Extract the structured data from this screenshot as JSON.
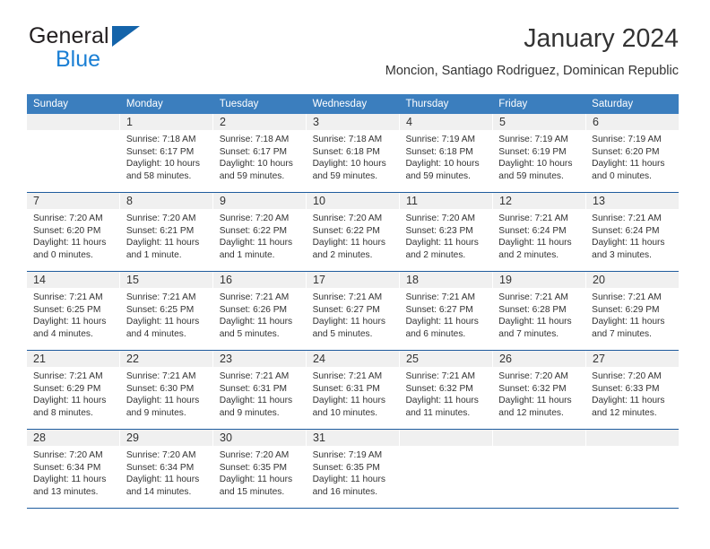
{
  "brand": {
    "name_top": "General",
    "name_bottom": "Blue",
    "triangle_color": "#1464aa",
    "blue_text_color": "#1a7fd4"
  },
  "header": {
    "title": "January 2024",
    "subtitle": "Moncion, Santiago Rodriguez, Dominican Republic"
  },
  "colors": {
    "header_blue": "#3b7ebe",
    "week_divider": "#1f5c9e",
    "daynum_band": "#f0f0f0",
    "text": "#333333"
  },
  "weekdays": [
    "Sunday",
    "Monday",
    "Tuesday",
    "Wednesday",
    "Thursday",
    "Friday",
    "Saturday"
  ],
  "labels": {
    "sunrise_prefix": "Sunrise:",
    "sunset_prefix": "Sunset:",
    "daylight_prefix": "Daylight:"
  },
  "weeks": [
    [
      {
        "day": "",
        "line1": "",
        "line2": "",
        "line3": "",
        "line4": ""
      },
      {
        "day": "1",
        "line1": "Sunrise: 7:18 AM",
        "line2": "Sunset: 6:17 PM",
        "line3": "Daylight: 10 hours",
        "line4": "and 58 minutes."
      },
      {
        "day": "2",
        "line1": "Sunrise: 7:18 AM",
        "line2": "Sunset: 6:17 PM",
        "line3": "Daylight: 10 hours",
        "line4": "and 59 minutes."
      },
      {
        "day": "3",
        "line1": "Sunrise: 7:18 AM",
        "line2": "Sunset: 6:18 PM",
        "line3": "Daylight: 10 hours",
        "line4": "and 59 minutes."
      },
      {
        "day": "4",
        "line1": "Sunrise: 7:19 AM",
        "line2": "Sunset: 6:18 PM",
        "line3": "Daylight: 10 hours",
        "line4": "and 59 minutes."
      },
      {
        "day": "5",
        "line1": "Sunrise: 7:19 AM",
        "line2": "Sunset: 6:19 PM",
        "line3": "Daylight: 10 hours",
        "line4": "and 59 minutes."
      },
      {
        "day": "6",
        "line1": "Sunrise: 7:19 AM",
        "line2": "Sunset: 6:20 PM",
        "line3": "Daylight: 11 hours",
        "line4": "and 0 minutes."
      }
    ],
    [
      {
        "day": "7",
        "line1": "Sunrise: 7:20 AM",
        "line2": "Sunset: 6:20 PM",
        "line3": "Daylight: 11 hours",
        "line4": "and 0 minutes."
      },
      {
        "day": "8",
        "line1": "Sunrise: 7:20 AM",
        "line2": "Sunset: 6:21 PM",
        "line3": "Daylight: 11 hours",
        "line4": "and 1 minute."
      },
      {
        "day": "9",
        "line1": "Sunrise: 7:20 AM",
        "line2": "Sunset: 6:22 PM",
        "line3": "Daylight: 11 hours",
        "line4": "and 1 minute."
      },
      {
        "day": "10",
        "line1": "Sunrise: 7:20 AM",
        "line2": "Sunset: 6:22 PM",
        "line3": "Daylight: 11 hours",
        "line4": "and 2 minutes."
      },
      {
        "day": "11",
        "line1": "Sunrise: 7:20 AM",
        "line2": "Sunset: 6:23 PM",
        "line3": "Daylight: 11 hours",
        "line4": "and 2 minutes."
      },
      {
        "day": "12",
        "line1": "Sunrise: 7:21 AM",
        "line2": "Sunset: 6:24 PM",
        "line3": "Daylight: 11 hours",
        "line4": "and 2 minutes."
      },
      {
        "day": "13",
        "line1": "Sunrise: 7:21 AM",
        "line2": "Sunset: 6:24 PM",
        "line3": "Daylight: 11 hours",
        "line4": "and 3 minutes."
      }
    ],
    [
      {
        "day": "14",
        "line1": "Sunrise: 7:21 AM",
        "line2": "Sunset: 6:25 PM",
        "line3": "Daylight: 11 hours",
        "line4": "and 4 minutes."
      },
      {
        "day": "15",
        "line1": "Sunrise: 7:21 AM",
        "line2": "Sunset: 6:25 PM",
        "line3": "Daylight: 11 hours",
        "line4": "and 4 minutes."
      },
      {
        "day": "16",
        "line1": "Sunrise: 7:21 AM",
        "line2": "Sunset: 6:26 PM",
        "line3": "Daylight: 11 hours",
        "line4": "and 5 minutes."
      },
      {
        "day": "17",
        "line1": "Sunrise: 7:21 AM",
        "line2": "Sunset: 6:27 PM",
        "line3": "Daylight: 11 hours",
        "line4": "and 5 minutes."
      },
      {
        "day": "18",
        "line1": "Sunrise: 7:21 AM",
        "line2": "Sunset: 6:27 PM",
        "line3": "Daylight: 11 hours",
        "line4": "and 6 minutes."
      },
      {
        "day": "19",
        "line1": "Sunrise: 7:21 AM",
        "line2": "Sunset: 6:28 PM",
        "line3": "Daylight: 11 hours",
        "line4": "and 7 minutes."
      },
      {
        "day": "20",
        "line1": "Sunrise: 7:21 AM",
        "line2": "Sunset: 6:29 PM",
        "line3": "Daylight: 11 hours",
        "line4": "and 7 minutes."
      }
    ],
    [
      {
        "day": "21",
        "line1": "Sunrise: 7:21 AM",
        "line2": "Sunset: 6:29 PM",
        "line3": "Daylight: 11 hours",
        "line4": "and 8 minutes."
      },
      {
        "day": "22",
        "line1": "Sunrise: 7:21 AM",
        "line2": "Sunset: 6:30 PM",
        "line3": "Daylight: 11 hours",
        "line4": "and 9 minutes."
      },
      {
        "day": "23",
        "line1": "Sunrise: 7:21 AM",
        "line2": "Sunset: 6:31 PM",
        "line3": "Daylight: 11 hours",
        "line4": "and 9 minutes."
      },
      {
        "day": "24",
        "line1": "Sunrise: 7:21 AM",
        "line2": "Sunset: 6:31 PM",
        "line3": "Daylight: 11 hours",
        "line4": "and 10 minutes."
      },
      {
        "day": "25",
        "line1": "Sunrise: 7:21 AM",
        "line2": "Sunset: 6:32 PM",
        "line3": "Daylight: 11 hours",
        "line4": "and 11 minutes."
      },
      {
        "day": "26",
        "line1": "Sunrise: 7:20 AM",
        "line2": "Sunset: 6:32 PM",
        "line3": "Daylight: 11 hours",
        "line4": "and 12 minutes."
      },
      {
        "day": "27",
        "line1": "Sunrise: 7:20 AM",
        "line2": "Sunset: 6:33 PM",
        "line3": "Daylight: 11 hours",
        "line4": "and 12 minutes."
      }
    ],
    [
      {
        "day": "28",
        "line1": "Sunrise: 7:20 AM",
        "line2": "Sunset: 6:34 PM",
        "line3": "Daylight: 11 hours",
        "line4": "and 13 minutes."
      },
      {
        "day": "29",
        "line1": "Sunrise: 7:20 AM",
        "line2": "Sunset: 6:34 PM",
        "line3": "Daylight: 11 hours",
        "line4": "and 14 minutes."
      },
      {
        "day": "30",
        "line1": "Sunrise: 7:20 AM",
        "line2": "Sunset: 6:35 PM",
        "line3": "Daylight: 11 hours",
        "line4": "and 15 minutes."
      },
      {
        "day": "31",
        "line1": "Sunrise: 7:19 AM",
        "line2": "Sunset: 6:35 PM",
        "line3": "Daylight: 11 hours",
        "line4": "and 16 minutes."
      },
      {
        "day": "",
        "line1": "",
        "line2": "",
        "line3": "",
        "line4": ""
      },
      {
        "day": "",
        "line1": "",
        "line2": "",
        "line3": "",
        "line4": ""
      },
      {
        "day": "",
        "line1": "",
        "line2": "",
        "line3": "",
        "line4": ""
      }
    ]
  ]
}
